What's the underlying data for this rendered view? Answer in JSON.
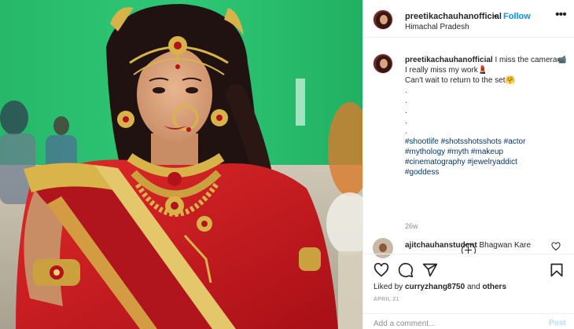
{
  "header": {
    "username": "preetikachauhanofficial",
    "separator": "•",
    "follow_label": "Follow",
    "location": "Himachal Pradesh",
    "more_icon": "more-dots-icon"
  },
  "caption": {
    "username": "preetikachauhanofficial",
    "line1": "I miss the camera📹 I really miss my work💄",
    "line2": "Can't wait to return to the set🤗",
    "dots": [
      ".",
      ".",
      ".",
      ".",
      "."
    ],
    "hashtags": [
      "#shootlife #shotsshotsshots #actor",
      "#mythology #myth #makeup",
      "#cinematography #jewelryaddict",
      "#goddess"
    ],
    "age": "26w"
  },
  "comment": {
    "username": "ajitchauhanstudent",
    "text": "Bhagwan Kare"
  },
  "actions": {
    "like_icon": "heart-icon",
    "comment_icon": "comment-icon",
    "share_icon": "share-icon",
    "save_icon": "bookmark-icon",
    "likes_prefix": "Liked by",
    "liked_by_user": "curryzhang8750",
    "likes_connector": "and",
    "likes_others": "others",
    "date": "APRIL 21"
  },
  "add_comment": {
    "placeholder": "Add a comment...",
    "post_label": "Post"
  },
  "colors": {
    "link_blue": "#0095f6",
    "hashtag_blue": "#00376b",
    "muted": "#8e8e8e",
    "post_disabled": "#b2dffc",
    "green_screen": "#2fbf71",
    "saree_red": "#c8191f"
  }
}
